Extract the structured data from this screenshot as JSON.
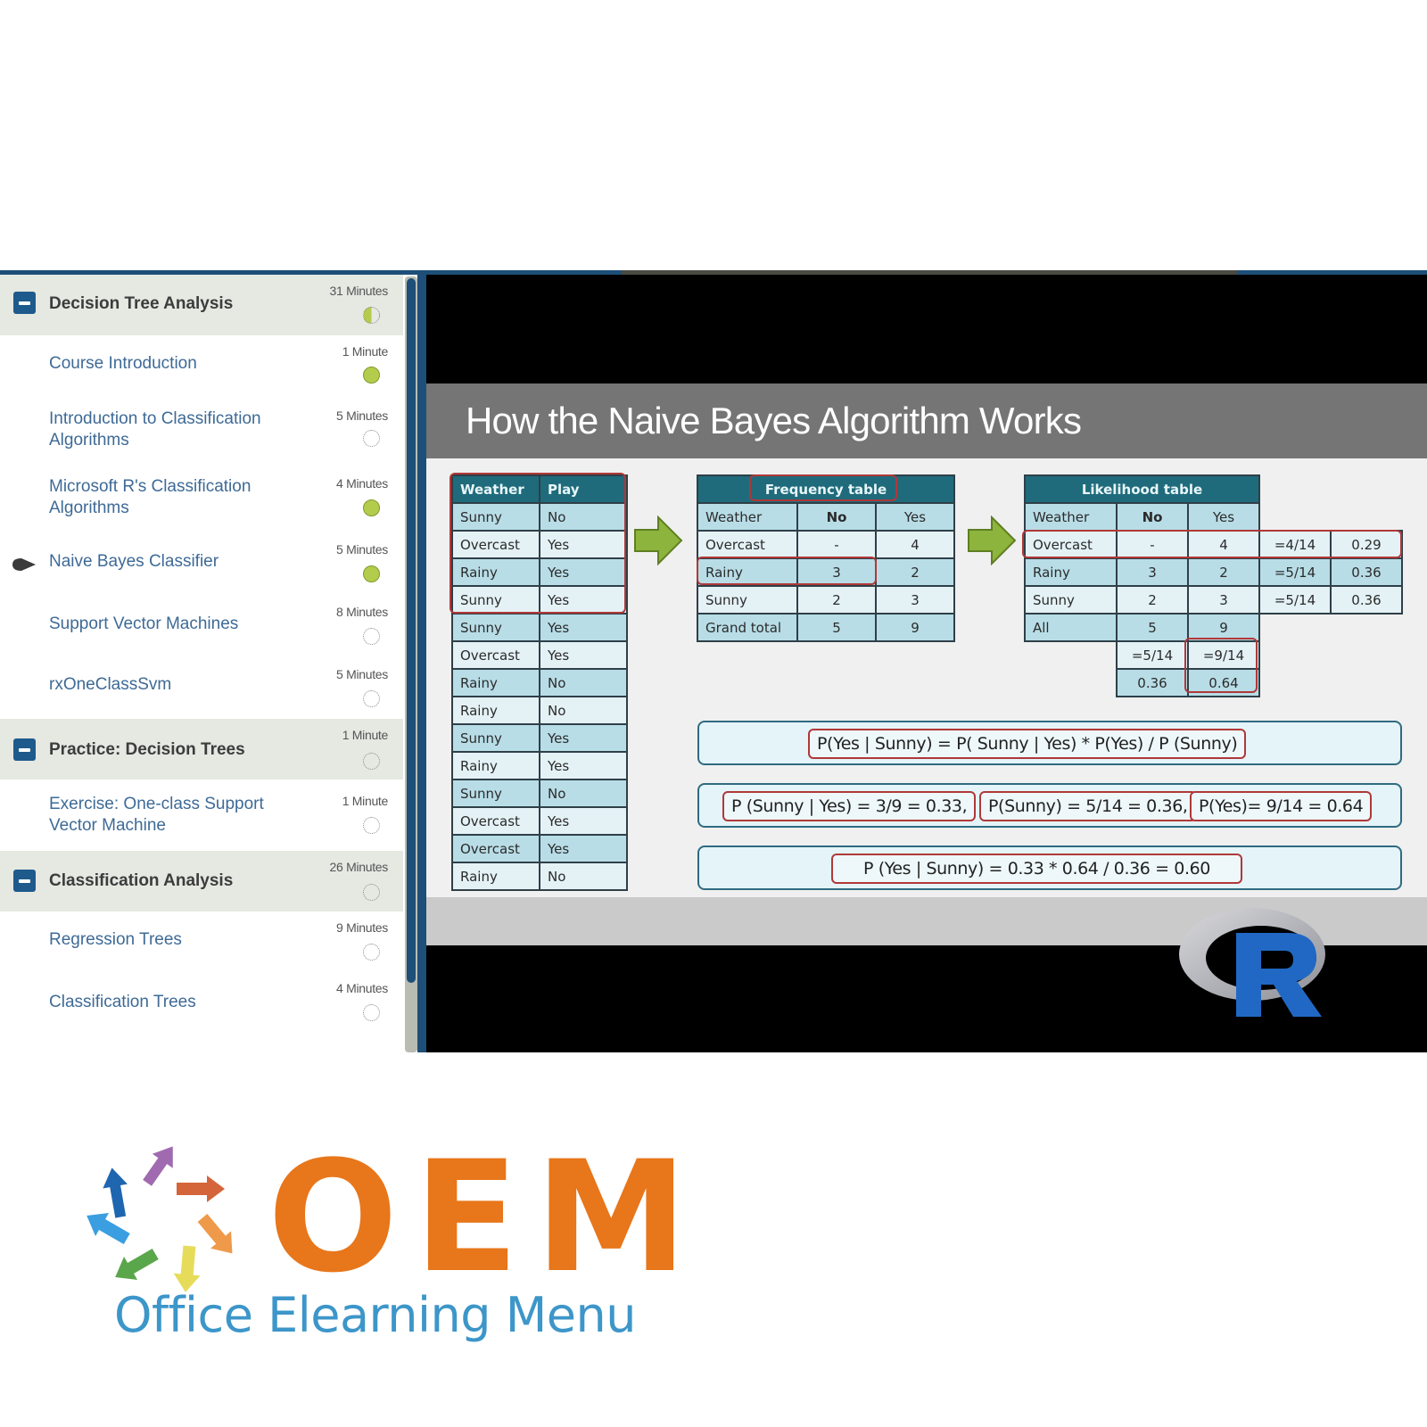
{
  "sidebar": {
    "sections": [
      {
        "title": "Decision Tree Analysis",
        "duration": "31 Minutes",
        "status": "partial",
        "lessons": [
          {
            "label": "Course Introduction",
            "duration": "1 Minute",
            "status": "complete"
          },
          {
            "label": "Introduction to Classification Algorithms",
            "duration": "5 Minutes",
            "status": "not-started"
          },
          {
            "label": "Microsoft R's Classification Algorithms",
            "duration": "4 Minutes",
            "status": "complete"
          },
          {
            "label": "Naive Bayes Classifier",
            "duration": "5 Minutes",
            "status": "complete",
            "current": true
          },
          {
            "label": "Support Vector Machines",
            "duration": "8 Minutes",
            "status": "not-started"
          },
          {
            "label": "rxOneClassSvm",
            "duration": "5 Minutes",
            "status": "not-started"
          }
        ]
      },
      {
        "title": "Practice: Decision Trees",
        "duration": "1 Minute",
        "status": "not-started",
        "lessons": [
          {
            "label": "Exercise: One-class Support Vector Machine",
            "duration": "1 Minute",
            "status": "not-started"
          }
        ]
      },
      {
        "title": "Classification Analysis",
        "duration": "26 Minutes",
        "status": "not-started",
        "lessons": [
          {
            "label": "Regression Trees",
            "duration": "9 Minutes",
            "status": "not-started"
          },
          {
            "label": "Classification Trees",
            "duration": "4 Minutes",
            "status": "not-started"
          }
        ]
      }
    ]
  },
  "slide": {
    "title": "How the Naive Bayes Algorithm Works",
    "raw_table": {
      "headers": [
        "Weather",
        "Play"
      ],
      "rows": [
        [
          "Sunny",
          "No"
        ],
        [
          "Overcast",
          "Yes"
        ],
        [
          "Rainy",
          "Yes"
        ],
        [
          "Sunny",
          "Yes"
        ],
        [
          "Sunny",
          "Yes"
        ],
        [
          "Overcast",
          "Yes"
        ],
        [
          "Rainy",
          "No"
        ],
        [
          "Rainy",
          "No"
        ],
        [
          "Sunny",
          "Yes"
        ],
        [
          "Rainy",
          "Yes"
        ],
        [
          "Sunny",
          "No"
        ],
        [
          "Overcast",
          "Yes"
        ],
        [
          "Overcast",
          "Yes"
        ],
        [
          "Rainy",
          "No"
        ]
      ]
    },
    "frequency_table": {
      "title": "Frequency table",
      "headers": [
        "Weather",
        "No",
        "Yes"
      ],
      "rows": [
        [
          "Overcast",
          "-",
          "4"
        ],
        [
          "Rainy",
          "3",
          "2"
        ],
        [
          "Sunny",
          "2",
          "3"
        ],
        [
          "Grand total",
          "5",
          "9"
        ]
      ]
    },
    "likelihood_table": {
      "title": "Likelihood table",
      "headers": [
        "Weather",
        "No",
        "Yes"
      ],
      "rows": [
        [
          "Overcast",
          "-",
          "4",
          "=4/14",
          "0.29"
        ],
        [
          "Rainy",
          "3",
          "2",
          "=5/14",
          "0.36"
        ],
        [
          "Sunny",
          "2",
          "3",
          "=5/14",
          "0.36"
        ],
        [
          "All",
          "5",
          "9"
        ]
      ],
      "footer_rows": [
        [
          "=5/14",
          "=9/14"
        ],
        [
          "0.36",
          "0.64"
        ]
      ]
    },
    "formulas": {
      "bayes_rule": "P(Yes | Sunny) = P( Sunny | Yes) * P(Yes) / P (Sunny)",
      "terms": [
        "P (Sunny | Yes) = 3/9 = 0.33,",
        "P(Sunny) = 5/14 = 0.36,",
        "P(Yes)= 9/14 = 0.64"
      ],
      "result": "P (Yes | Sunny) = 0.33 * 0.64 / 0.36 = 0.60"
    },
    "logo": "R"
  },
  "brand": {
    "wordmark": "OEM",
    "tagline": "Office Elearning Menu",
    "colors": {
      "orange": "#e8761a",
      "blue": "#3d96c9"
    }
  },
  "colors": {
    "sidebar_accent": "#1e5a8c",
    "status_complete": "#b4cc4c",
    "table_header": "#1f6b7c",
    "highlight_border": "#b03838",
    "arrow_green": "#8db43c"
  }
}
